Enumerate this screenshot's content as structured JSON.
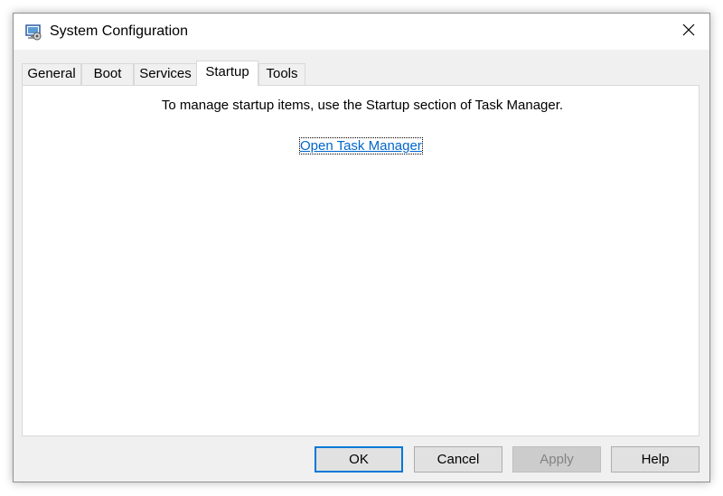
{
  "window": {
    "title": "System Configuration",
    "app_icon": "msconfig-icon",
    "close_icon": "close-icon"
  },
  "tabs": [
    {
      "label": "General",
      "active": false
    },
    {
      "label": "Boot",
      "active": false
    },
    {
      "label": "Services",
      "active": false
    },
    {
      "label": "Startup",
      "active": true
    },
    {
      "label": "Tools",
      "active": false
    }
  ],
  "startup_panel": {
    "message": "To manage startup items, use the Startup section of Task Manager.",
    "link_label": "Open Task Manager"
  },
  "buttons": {
    "ok": "OK",
    "cancel": "Cancel",
    "apply": "Apply",
    "help": "Help"
  },
  "colors": {
    "link": "#0066cc",
    "default_button_border": "#0078d7",
    "window_background": "#f0f0f0"
  }
}
